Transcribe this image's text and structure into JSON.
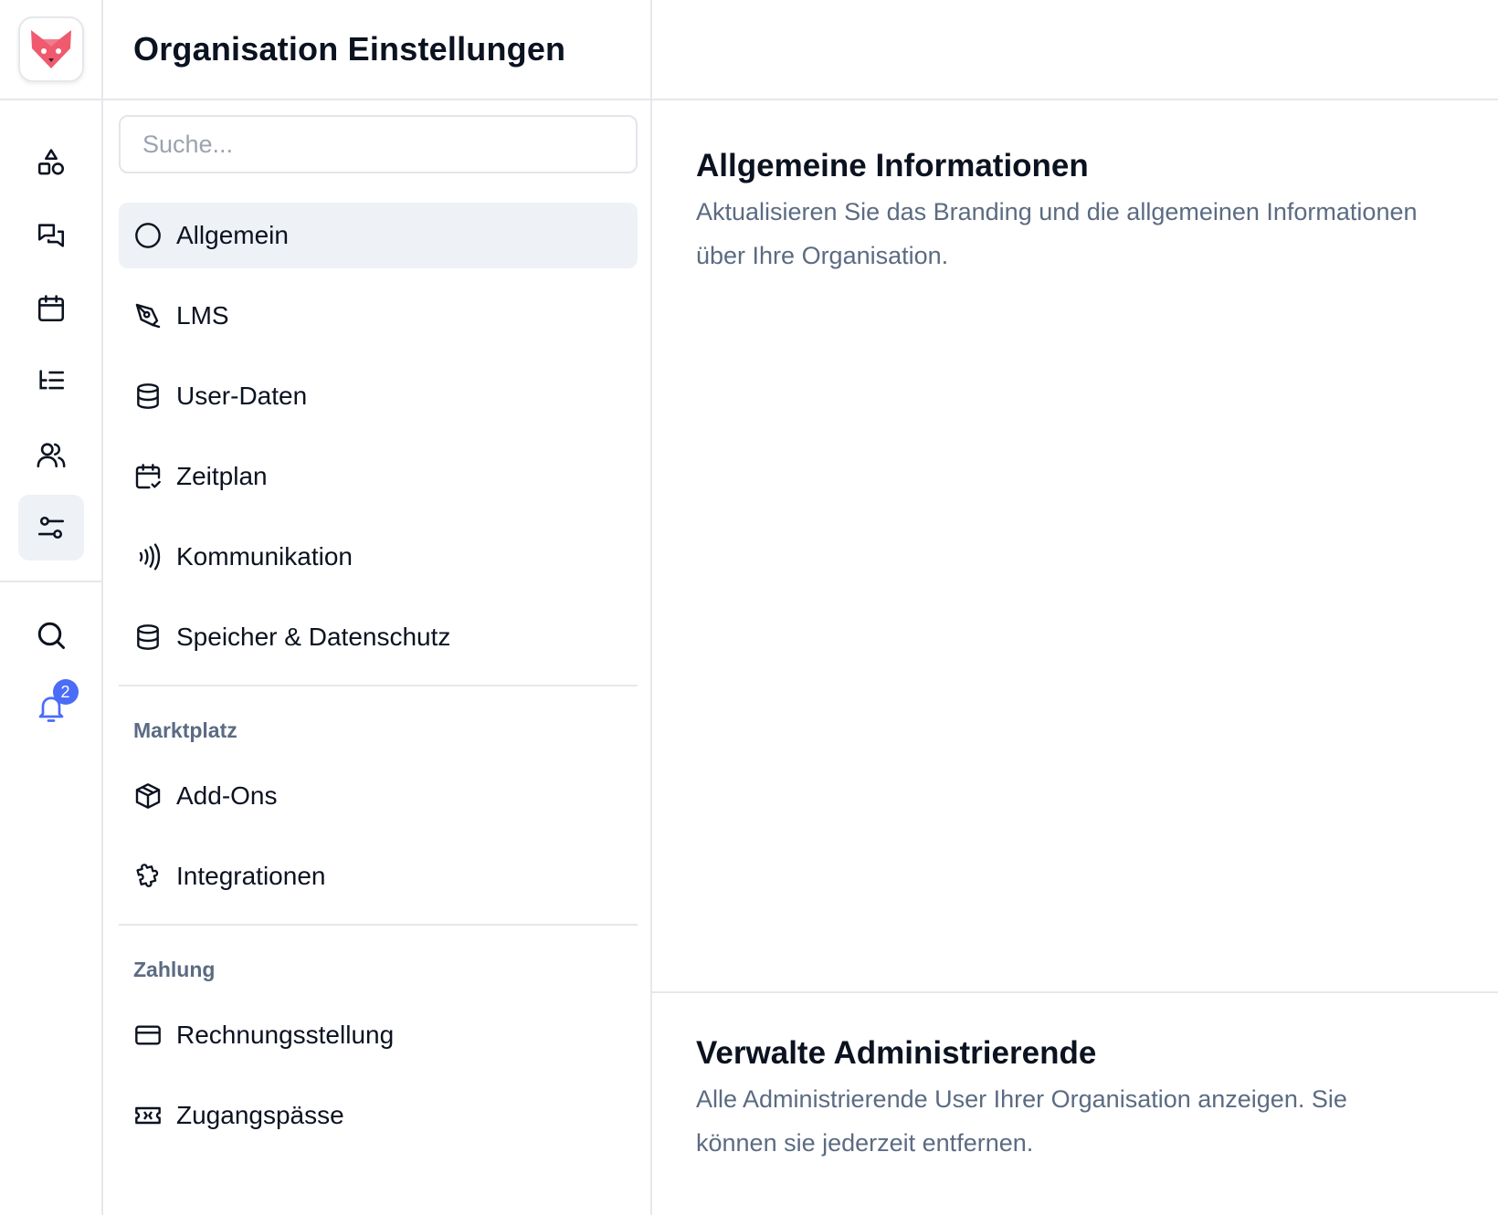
{
  "app": {
    "logo_name": "fox-logo",
    "accent": "#4a6cf7",
    "logo_color": "#ef5a6f"
  },
  "rail": {
    "items": [
      {
        "icon": "shapes-icon",
        "active": false
      },
      {
        "icon": "chat-icon",
        "active": false
      },
      {
        "icon": "calendar-icon",
        "active": false
      },
      {
        "icon": "list-tree-icon",
        "active": false
      },
      {
        "icon": "users-icon",
        "active": false
      },
      {
        "icon": "sliders-icon",
        "active": true
      }
    ],
    "bottom": [
      {
        "icon": "search-icon"
      },
      {
        "icon": "bell-icon",
        "badge": "2"
      }
    ]
  },
  "sidebar": {
    "title": "Organisation Einstellungen",
    "search_placeholder": "Suche...",
    "items": [
      {
        "label": "Allgemein",
        "icon": "circle-icon",
        "active": true
      },
      {
        "label": "LMS",
        "icon": "pen-tool-icon"
      },
      {
        "label": "User-Daten",
        "icon": "database-icon"
      },
      {
        "label": "Zeitplan",
        "icon": "calendar-check-icon"
      },
      {
        "label": "Kommunikation",
        "icon": "signal-icon"
      },
      {
        "label": "Speicher & Datenschutz",
        "icon": "database-icon"
      }
    ],
    "marketplace_label": "Marktplatz",
    "marketplace_items": [
      {
        "label": "Add-Ons",
        "icon": "package-icon"
      },
      {
        "label": "Integrationen",
        "icon": "puzzle-icon"
      }
    ],
    "payment_label": "Zahlung",
    "payment_items": [
      {
        "label": "Rechnungsstellung",
        "icon": "credit-card-icon"
      },
      {
        "label": "Zugangspässe",
        "icon": "ticket-icon"
      }
    ]
  },
  "main": {
    "general": {
      "title": "Allgemeine Informationen",
      "description": "Aktualisieren Sie das Branding und die allgemeinen Informationen über Ihre Organisation."
    },
    "admins": {
      "title": "Verwalte Administrierende",
      "description": "Alle Administrierende User Ihrer Organisation anzeigen. Sie können sie jederzeit entfernen."
    }
  }
}
